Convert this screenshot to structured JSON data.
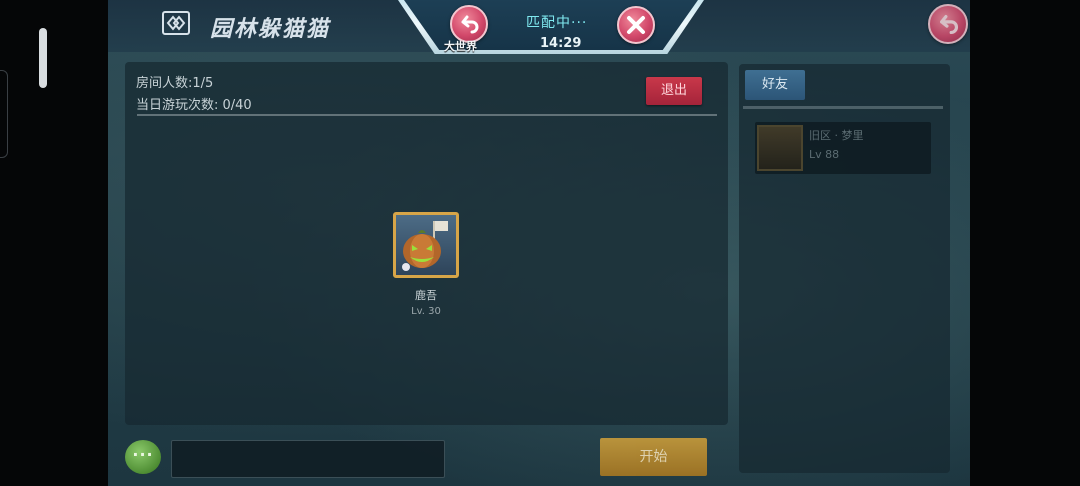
{
  "header": {
    "title": "园林躲猫猫",
    "big_world_label": "大世界",
    "matching_label": "匹配中···",
    "timer": "14:29"
  },
  "room": {
    "member_count": "房间人数:1/5",
    "daily_plays": "当日游玩次数: 0/40",
    "exit_label": "退出",
    "players": [
      {
        "name": "鹿吾",
        "level": "Lv. 30"
      }
    ]
  },
  "friends": {
    "tab_label": "好友",
    "items": [
      {
        "name": "旧区 · 梦里",
        "level": "Lv 88"
      }
    ]
  },
  "bottom": {
    "more_label": "···",
    "start_label": "开始"
  },
  "icons": {
    "logo": "game-logo-icon",
    "back": "back-arrow-icon",
    "close": "close-x-icon"
  },
  "colors": {
    "accent_red": "#d2486a",
    "matching_cyan": "#7fe8ef",
    "start_gold": "#d3a23a",
    "exit_red": "#c9384a"
  }
}
